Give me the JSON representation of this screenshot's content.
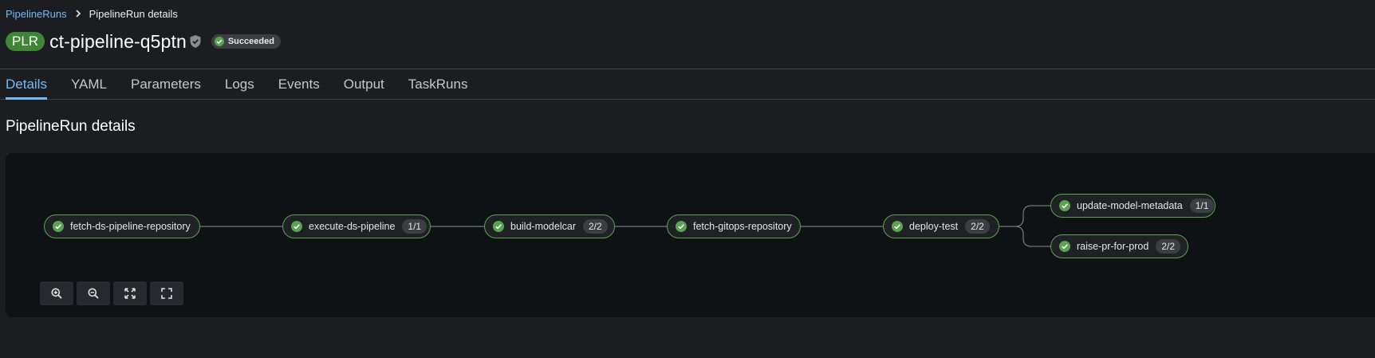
{
  "breadcrumb": {
    "parent": "PipelineRuns",
    "current": "PipelineRun details"
  },
  "header": {
    "resource_badge": "PLR",
    "title": "ct-pipeline-q5ptn",
    "status": "Succeeded"
  },
  "tabs": [
    {
      "label": "Details",
      "active": true
    },
    {
      "label": "YAML"
    },
    {
      "label": "Parameters"
    },
    {
      "label": "Logs"
    },
    {
      "label": "Events"
    },
    {
      "label": "Output"
    },
    {
      "label": "TaskRuns"
    }
  ],
  "section": {
    "title": "PipelineRun details"
  },
  "pipeline": {
    "nodes": [
      {
        "name": "fetch-ds-pipeline-repository",
        "count": ""
      },
      {
        "name": "execute-ds-pipeline",
        "count": "1/1"
      },
      {
        "name": "build-modelcar",
        "count": "2/2"
      },
      {
        "name": "fetch-gitops-repository",
        "count": ""
      },
      {
        "name": "deploy-test",
        "count": "2/2"
      },
      {
        "name": "update-model-metadata",
        "count": "1/1"
      },
      {
        "name": "raise-pr-for-prod",
        "count": "2/2"
      }
    ]
  },
  "controls": {
    "icons": [
      "zoom-in-icon",
      "zoom-out-icon",
      "reset-view-icon",
      "fit-to-screen-icon"
    ]
  },
  "colors": {
    "success": "#3e8635",
    "node_border": "#5ba352",
    "link": "#73bcf7"
  }
}
